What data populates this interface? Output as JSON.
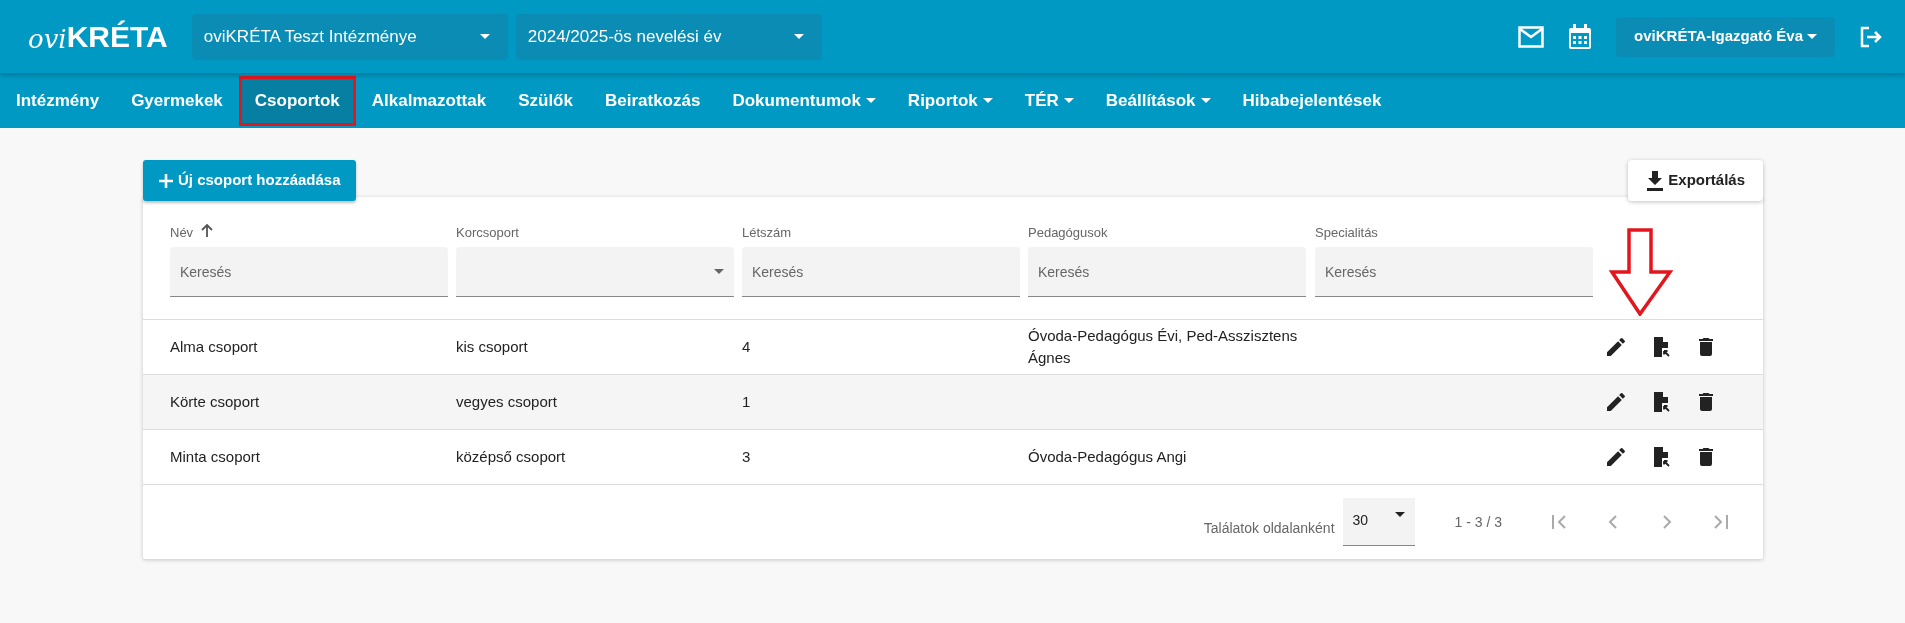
{
  "header": {
    "logo_prefix": "ovi",
    "logo_main": "KRÉTA",
    "institution": "oviKRÉTA Teszt Intézménye",
    "school_year": "2024/2025-ös nevelési év",
    "user": "oviKRÉTA-Igazgató Éva"
  },
  "nav": [
    {
      "label": "Intézmény",
      "dropdown": false,
      "selected": false,
      "highlighted": false
    },
    {
      "label": "Gyermekek",
      "dropdown": false,
      "selected": false,
      "highlighted": false
    },
    {
      "label": "Csoportok",
      "dropdown": false,
      "selected": true,
      "highlighted": true
    },
    {
      "label": "Alkalmazottak",
      "dropdown": false,
      "selected": false,
      "highlighted": false
    },
    {
      "label": "Szülők",
      "dropdown": false,
      "selected": false,
      "highlighted": false
    },
    {
      "label": "Beiratkozás",
      "dropdown": false,
      "selected": false,
      "highlighted": false
    },
    {
      "label": "Dokumentumok",
      "dropdown": true,
      "selected": false,
      "highlighted": false
    },
    {
      "label": "Riportok",
      "dropdown": true,
      "selected": false,
      "highlighted": false
    },
    {
      "label": "TÉR",
      "dropdown": true,
      "selected": false,
      "highlighted": false
    },
    {
      "label": "Beállítások",
      "dropdown": true,
      "selected": false,
      "highlighted": false
    },
    {
      "label": "Hibabejelentések",
      "dropdown": false,
      "selected": false,
      "highlighted": false
    }
  ],
  "add_button": "Új csoport hozzáadása",
  "export_button": "Exportálás",
  "table": {
    "columns": [
      {
        "label": "Név",
        "sorted": true,
        "kind": "text",
        "placeholder": "Keresés"
      },
      {
        "label": "Korcsoport",
        "sorted": false,
        "kind": "select"
      },
      {
        "label": "Létszám",
        "sorted": false,
        "kind": "text",
        "placeholder": "Keresés"
      },
      {
        "label": "Pedagógusok",
        "sorted": false,
        "kind": "text",
        "placeholder": "Keresés"
      },
      {
        "label": "Specialitás",
        "sorted": false,
        "kind": "text",
        "placeholder": "Keresés"
      }
    ],
    "rows": [
      [
        "Alma csoport",
        "kis csoport",
        "4",
        "Óvoda-Pedagógus Évi, Ped-Asszisztens Ágnes",
        ""
      ],
      [
        "Körte csoport",
        "vegyes csoport",
        "1",
        "",
        ""
      ],
      [
        "Minta csoport",
        "középső csoport",
        "3",
        "Óvoda-Pedagógus Angi",
        ""
      ]
    ],
    "annotation_arrow": true
  },
  "pagination": {
    "per_page_label": "Találatok oldalanként",
    "per_page": "30",
    "range": "1 - 3 / 3"
  }
}
